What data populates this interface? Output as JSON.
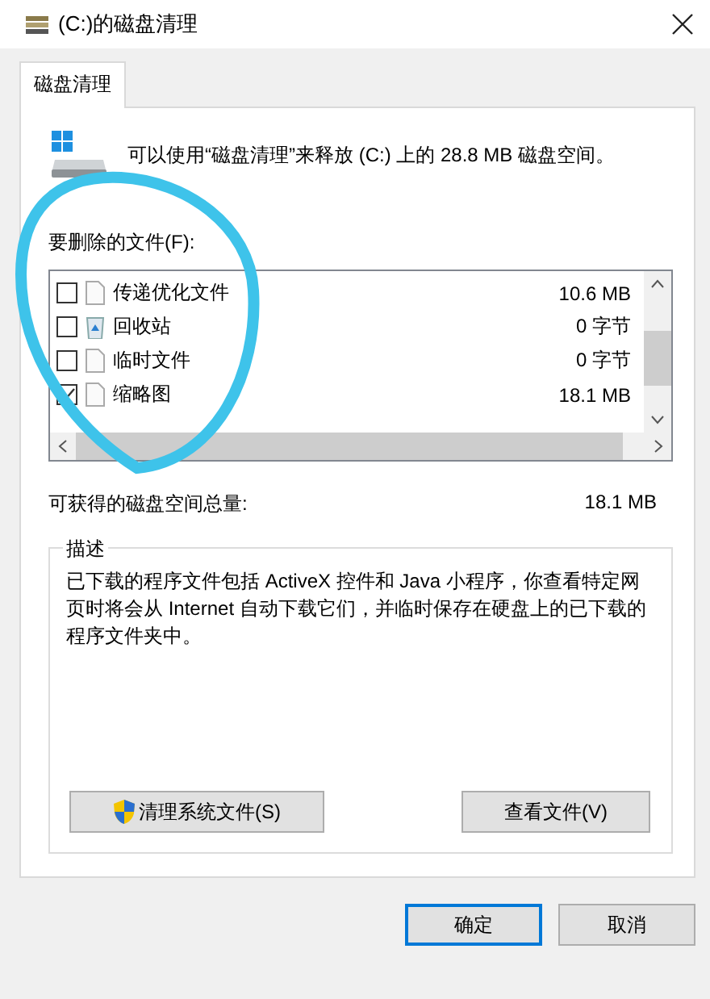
{
  "window": {
    "title": "(C:)的磁盘清理"
  },
  "tabs": [
    {
      "label": "磁盘清理",
      "selected": true
    }
  ],
  "summary": "可以使用“磁盘清理”来释放 (C:) 上的 28.8 MB 磁盘空间。",
  "files_label": "要删除的文件(F):",
  "files": [
    {
      "name": "传递优化文件",
      "size": "10.6 MB",
      "checked": false,
      "kind": "file"
    },
    {
      "name": "回收站",
      "size": "0 字节",
      "checked": false,
      "kind": "recycle"
    },
    {
      "name": "临时文件",
      "size": "0 字节",
      "checked": false,
      "kind": "file"
    },
    {
      "name": "缩略图",
      "size": "18.1 MB",
      "checked": true,
      "kind": "file"
    }
  ],
  "total": {
    "label": "可获得的磁盘空间总量:",
    "value": "18.1 MB"
  },
  "description": {
    "title": "描述",
    "text": "已下载的程序文件包括 ActiveX 控件和 Java 小程序，你查看特定网页时将会从 Internet 自动下载它们，并临时保存在硬盘上的已下载的程序文件夹中。"
  },
  "panel_buttons": [
    {
      "label": "清理系统文件(S)",
      "kind": "shield"
    },
    {
      "label": "查看文件(V)",
      "kind": "plain"
    }
  ],
  "dialog_buttons": [
    {
      "label": "确定",
      "default": true
    },
    {
      "label": "取消",
      "default": false
    }
  ]
}
